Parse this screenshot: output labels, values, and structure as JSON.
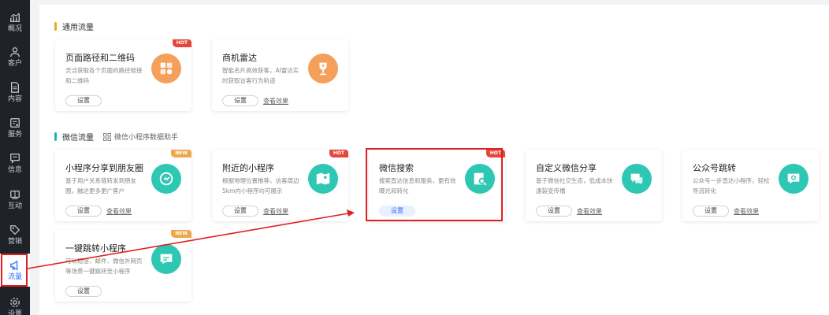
{
  "sidebar": {
    "items": [
      {
        "label": "概况",
        "icon": "bar-chart-icon"
      },
      {
        "label": "客户",
        "icon": "user-icon"
      },
      {
        "label": "内容",
        "icon": "document-icon"
      },
      {
        "label": "服务",
        "icon": "service-icon"
      },
      {
        "label": "信息",
        "icon": "message-icon"
      },
      {
        "label": "互动",
        "icon": "interaction-icon"
      },
      {
        "label": "营销",
        "icon": "tag-icon"
      },
      {
        "label": "流量",
        "icon": "megaphone-icon",
        "active": true
      },
      {
        "label": "设置",
        "icon": "gear-icon"
      }
    ]
  },
  "sections": {
    "general": {
      "title": "通用流量",
      "accent": "#f5a623"
    },
    "wechat": {
      "title": "微信流量",
      "accent": "#1fb5ad",
      "helper_link": "微信小程序数据助手"
    }
  },
  "cards": {
    "path_qrcode": {
      "title": "页面路径和二维码",
      "desc": "灵活获取各个页面的路径链接和二维码",
      "badge": "HOT",
      "button": "设置",
      "icon": "qrcode-icon",
      "color": "#f5a05a"
    },
    "radar": {
      "title": "商机雷达",
      "desc": "智能名片高效获客，AI雷达实时获取访客行为轨迹",
      "button": "设置",
      "link": "查看效果",
      "icon": "trophy-icon",
      "color": "#f5a05a"
    },
    "share_moments": {
      "title": "小程序分享到朋友圈",
      "desc": "基于用户关系链转发到朋友圈，触达更多更广客户",
      "badge": "NEW",
      "button": "设置",
      "link": "查看效果",
      "icon": "share-icon",
      "color": "#2ec7b4"
    },
    "nearby": {
      "title": "附近的小程序",
      "desc": "根据地理位置推荐，访客周边5km内小程序均可展示",
      "badge": "HOT",
      "button": "设置",
      "link": "查看效果",
      "icon": "map-icon",
      "color": "#2ec7b4"
    },
    "search": {
      "title": "微信搜索",
      "desc": "搜索直达信息和服务，更有效曝光和转化",
      "badge": "HOT",
      "button": "设置",
      "icon": "search-doc-icon",
      "color": "#2ec7b4"
    },
    "custom_share": {
      "title": "自定义微信分享",
      "desc": "基于微信社交生态，低成本快速裂变传播",
      "button": "设置",
      "link": "查看效果",
      "icon": "chat-icon",
      "color": "#2ec7b4"
    },
    "official_jump": {
      "title": "公众号跳转",
      "desc": "公众号一步直达小程序，轻松导流转化",
      "button": "设置",
      "link": "查看效果",
      "icon": "bubble-icon",
      "color": "#2ec7b4"
    },
    "one_click": {
      "title": "一键跳转小程序",
      "desc": "可以短信、邮件、微信外网页等场景一键跳转至小程序",
      "badge": "NEW",
      "button": "设置",
      "icon": "link-bubble-icon",
      "color": "#2ec7b4"
    }
  },
  "annotation": {
    "color": "#e02020"
  }
}
